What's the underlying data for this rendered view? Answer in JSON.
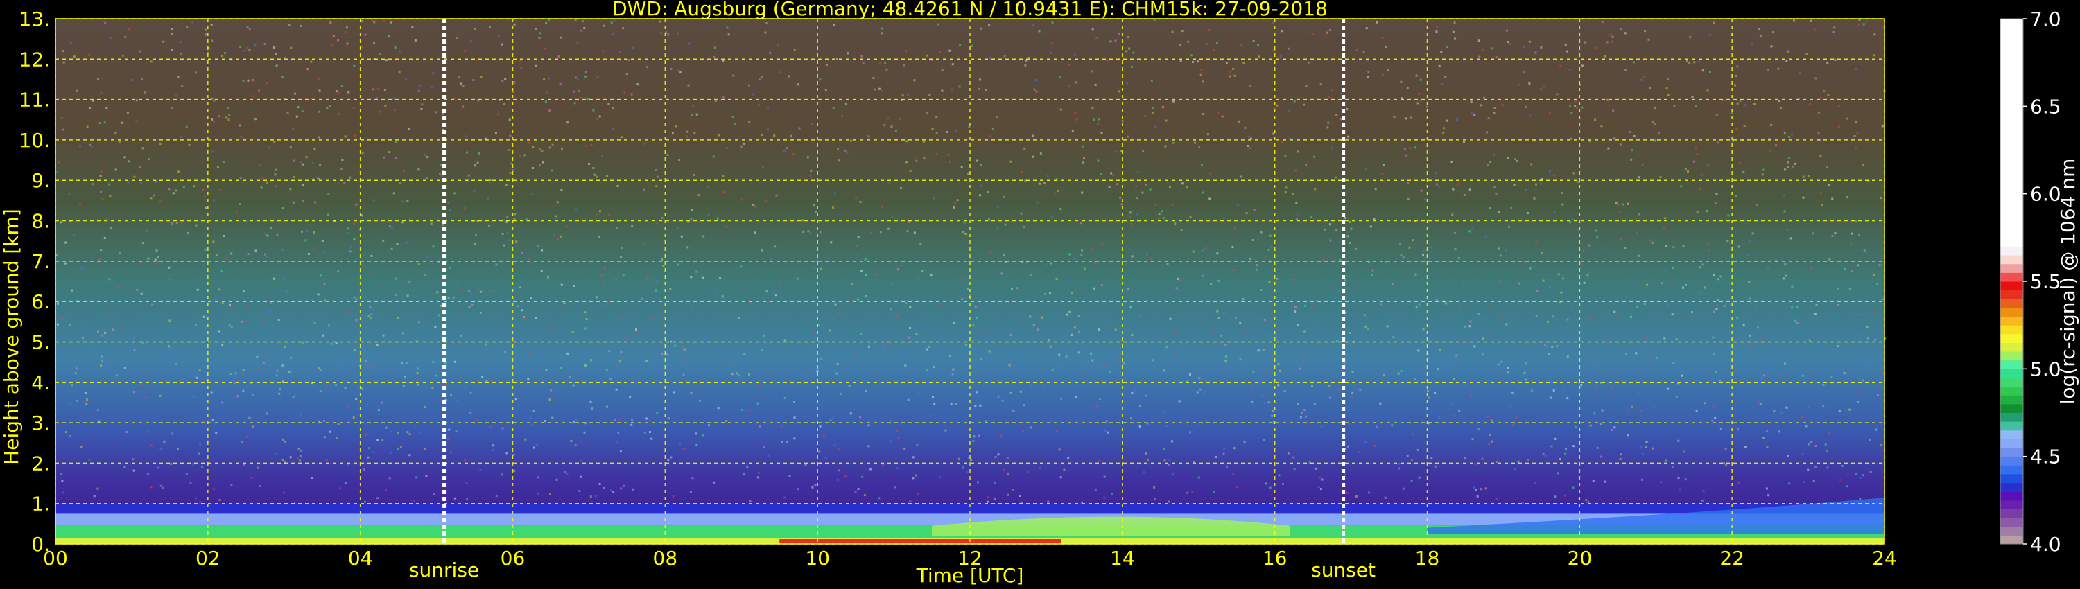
{
  "chart_data": {
    "type": "heatmap",
    "title": "DWD: Augsburg (Germany; 48.4261 N / 10.9431 E):    CHM15k: 27-09-2018",
    "xlabel": "Time [UTC]",
    "ylabel": "Height above ground [km]",
    "xlim": [
      0,
      24
    ],
    "ylim": [
      0,
      13
    ],
    "x_ticks": [
      "00",
      "02",
      "04",
      "06",
      "08",
      "10",
      "12",
      "14",
      "16",
      "18",
      "20",
      "22",
      "24"
    ],
    "y_ticks": [
      "0.",
      "1.",
      "2.",
      "3.",
      "4.",
      "5.",
      "6.",
      "7.",
      "8.",
      "9.",
      "10.",
      "11.",
      "12.",
      "13."
    ],
    "grid": true,
    "sunrise_hour": 5.1,
    "sunset_hour": 16.9,
    "sunrise_label": "sunrise",
    "sunset_label": "sunset",
    "colorbar": {
      "label": "log(rc-signal) @ 1064 nm",
      "range": [
        4.0,
        7.0
      ],
      "ticks": [
        "4.0",
        "4.5",
        "5.0",
        "5.5",
        "6.0",
        "6.5",
        "7.0"
      ],
      "levels": [
        [
          4.0,
          "#b8a0a0"
        ],
        [
          4.05,
          "#a07ca8"
        ],
        [
          4.1,
          "#8c5aa8"
        ],
        [
          4.15,
          "#7a3ca8"
        ],
        [
          4.2,
          "#6a1fb0"
        ],
        [
          4.25,
          "#5a10b8"
        ],
        [
          4.3,
          "#2a30d0"
        ],
        [
          4.35,
          "#2050e0"
        ],
        [
          4.4,
          "#3070f0"
        ],
        [
          4.45,
          "#5080f0"
        ],
        [
          4.5,
          "#7090f0"
        ],
        [
          4.55,
          "#88a8f8"
        ],
        [
          4.6,
          "#90b8f8"
        ],
        [
          4.65,
          "#40c0a0"
        ],
        [
          4.7,
          "#20a070"
        ],
        [
          4.75,
          "#109030"
        ],
        [
          4.8,
          "#20b040"
        ],
        [
          4.85,
          "#30c850"
        ],
        [
          4.9,
          "#40d870"
        ],
        [
          4.95,
          "#30e090"
        ],
        [
          5.0,
          "#50f0a0"
        ],
        [
          5.05,
          "#a0f060"
        ],
        [
          5.1,
          "#d8f040"
        ],
        [
          5.15,
          "#f8f830"
        ],
        [
          5.2,
          "#f8e020"
        ],
        [
          5.25,
          "#f8b820"
        ],
        [
          5.3,
          "#f09010"
        ],
        [
          5.35,
          "#e86020"
        ],
        [
          5.4,
          "#e83020"
        ],
        [
          5.45,
          "#e81010"
        ],
        [
          5.5,
          "#f05050"
        ],
        [
          5.55,
          "#f0a0a0"
        ],
        [
          5.6,
          "#f8d8d0"
        ],
        [
          5.65,
          "#f8f0f8"
        ],
        [
          5.7,
          "#ffffff"
        ]
      ]
    },
    "profile_layers": [
      {
        "height_km": [
          0.0,
          0.15
        ],
        "value": 5.1
      },
      {
        "height_km": [
          0.15,
          0.45
        ],
        "value": 4.9
      },
      {
        "height_km": [
          0.45,
          0.75
        ],
        "value": 4.55
      },
      {
        "height_km": [
          0.75,
          1.0
        ],
        "value": 4.3
      },
      {
        "height_km": [
          1.0,
          13.0
        ],
        "value": 4.4
      }
    ]
  }
}
